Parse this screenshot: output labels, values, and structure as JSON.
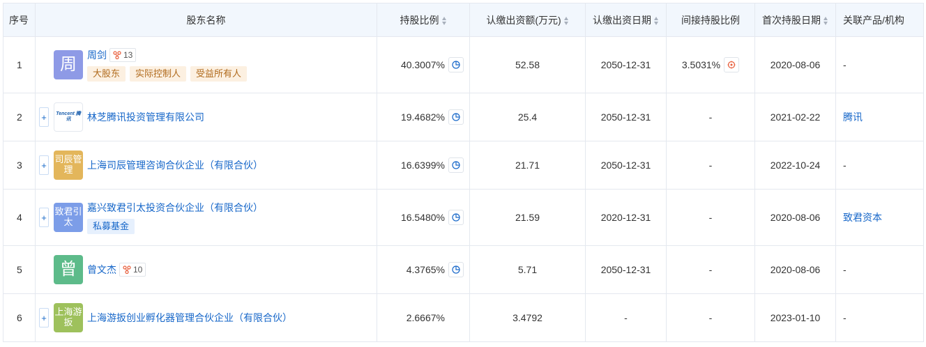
{
  "columns": {
    "seq": "序号",
    "name": "股东名称",
    "ratio": "持股比例",
    "capital": "认缴出资额(万元)",
    "date": "认缴出资日期",
    "indirect": "间接持股比例",
    "first": "首次持股日期",
    "related": "关联产品/机构"
  },
  "rows": [
    {
      "seq": "1",
      "avatar": "周",
      "name": "周剑",
      "rel": "13",
      "tags": [
        "大股东",
        "实际控制人",
        "受益所有人"
      ],
      "ratio": "40.3007%",
      "capital": "52.58",
      "date": "2050-12-31",
      "indirect": "3.5031%",
      "first": "2020-08-06",
      "related": "-"
    },
    {
      "seq": "2",
      "avatar": "Tencent 腾讯",
      "name": "林芝腾讯投资管理有限公司",
      "ratio": "19.4682%",
      "capital": "25.4",
      "date": "2050-12-31",
      "indirect": "-",
      "first": "2021-02-22",
      "related": "腾讯"
    },
    {
      "seq": "3",
      "avatar": "司辰管理",
      "name": "上海司辰管理咨询合伙企业（有限合伙）",
      "ratio": "16.6399%",
      "capital": "21.71",
      "date": "2050-12-31",
      "indirect": "-",
      "first": "2022-10-24",
      "related": "-"
    },
    {
      "seq": "4",
      "avatar": "致君引太",
      "name": "嘉兴致君引太投资合伙企业（有限合伙）",
      "tags": [
        "私募基金"
      ],
      "ratio": "16.5480%",
      "capital": "21.59",
      "date": "2020-12-31",
      "indirect": "-",
      "first": "2020-08-06",
      "related": "致君资本"
    },
    {
      "seq": "5",
      "avatar": "曾",
      "name": "曾文杰",
      "rel": "10",
      "ratio": "4.3765%",
      "capital": "5.71",
      "date": "2050-12-31",
      "indirect": "-",
      "first": "2020-08-06",
      "related": "-"
    },
    {
      "seq": "6",
      "avatar": "上海游扳",
      "name": "上海游扳创业孵化器管理合伙企业（有限合伙）",
      "ratio": "2.6667%",
      "capital": "3.4792",
      "date": "-",
      "indirect": "-",
      "first": "2023-01-10",
      "related": "-"
    }
  ],
  "colors": {
    "link": "#1767c9",
    "header_bg": "#f2f7fd",
    "avatar_zhou": "#8e9ae6",
    "avatar_sichen": "#e3b65b",
    "avatar_zhijun": "#7c9de8",
    "avatar_zeng": "#5dbb8a",
    "avatar_youban": "#9ec15c"
  },
  "icons": {
    "relation": "relation-graph-icon",
    "ratio_chart": "pie-chart-icon",
    "penetration": "equity-penetration-icon",
    "expand": "plus-icon"
  }
}
